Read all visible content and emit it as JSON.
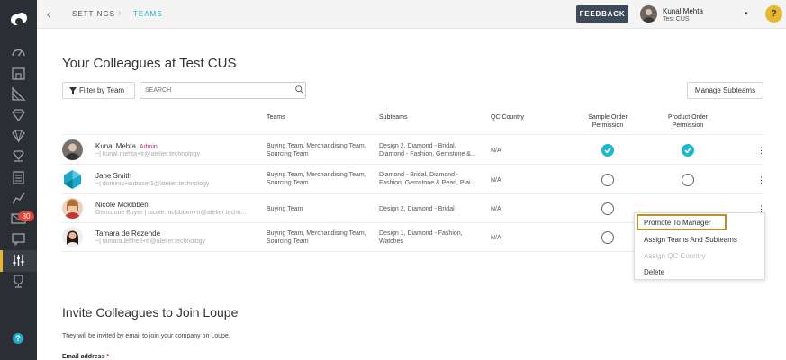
{
  "breadcrumb": {
    "back_icon": "chevron-left-icon",
    "settings": "SETTINGS",
    "separator": "›",
    "teams": "TEAMS"
  },
  "topbar": {
    "feedback_label": "FEEDBACK",
    "user_name": "Kunal Mehta",
    "user_company": "Test CUS",
    "caret": "▾",
    "help_label": "?"
  },
  "sidebar": {
    "badge_count": "30",
    "help_label": "?",
    "icons": [
      "cloud-logo-icon",
      "speedometer-icon",
      "building-icon",
      "chart-stack-icon",
      "diamond-icon",
      "diamond-outline-icon",
      "diamond-stack-icon",
      "clipboard-icon",
      "trend-line-icon",
      "mail-icon",
      "chat-icon",
      "sliders-icon",
      "trophy-icon",
      "help-icon"
    ],
    "accent_color": "#e7b72f"
  },
  "page": {
    "title": "Your Colleagues at Test CUS",
    "filter_label": "Filter by Team",
    "search_placeholder": "SEARCH",
    "manage_label": "Manage Subteams"
  },
  "table": {
    "headers": {
      "teams": "Teams",
      "subteams": "Subteams",
      "qc": "QC Country",
      "sample": "Sample Order Permission",
      "product": "Product Order Permission"
    },
    "rows": [
      {
        "name": "Kunal Mehta",
        "admin": "Admin",
        "email": "~| kunal.mehta+tr@atelier.technology",
        "teams": "Buying Team, Merchandising Team, Sourcing Team",
        "subteams": "Design 2, Diamond - Bridal, Diamond - Fashion, Gemstone &...",
        "qc": "N/A",
        "sample": true,
        "product": true
      },
      {
        "name": "Jane Smith",
        "admin": "",
        "email": "~| dominic+subuser1@atelier.technology",
        "teams": "Buying Team, Merchandising Team, Sourcing Team",
        "subteams": "Diamond - Bridal, Diamond - Fashion, Gemstone & Pearl, Plai...",
        "qc": "N/A",
        "sample": false,
        "product": false
      },
      {
        "name": "Nicole Mckibben",
        "admin": "",
        "email": "Gemstone Buyer | nicole.mckibben+tr@atelier.techn...",
        "teams": "Buying Team",
        "subteams": "Design 2, Diamond - Bridal",
        "qc": "N/A",
        "sample": false,
        "product": false
      },
      {
        "name": "Tamara de Rezende",
        "admin": "",
        "email": "~| tamara.leffheit+tr@atelier.technology",
        "teams": "Buying Team, Merchandising Team, Sourcing Team",
        "subteams": "Design 1, Diamond - Fashion, Watches",
        "qc": "N/A",
        "sample": false,
        "product": false
      }
    ],
    "kebab": "⋮"
  },
  "context_menu": {
    "items": [
      "Promote To Manager",
      "Assign Teams And Subteams",
      "Assign QC Country",
      "Delete"
    ]
  },
  "invite": {
    "title": "Invite Colleagues to Join Loupe",
    "subtitle": "They will be invited by email to join your company on Loupe.",
    "email_label": "Email address",
    "required_mark": "*"
  }
}
